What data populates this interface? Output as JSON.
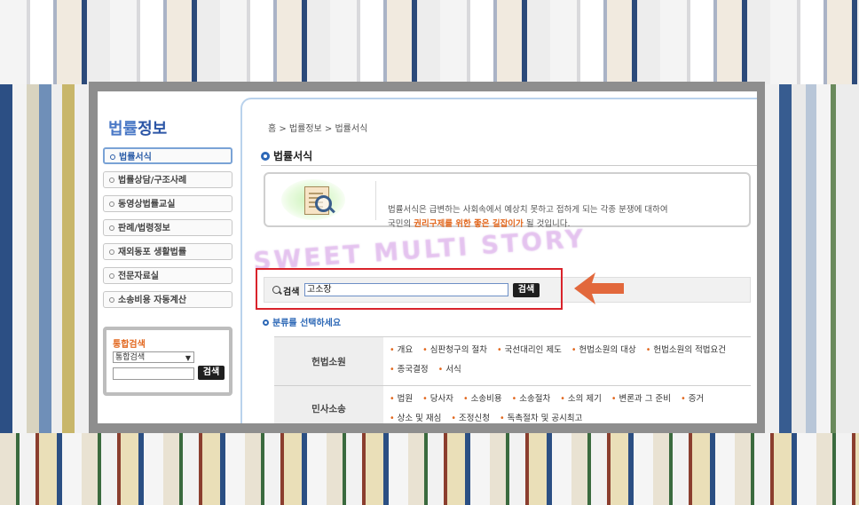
{
  "sidebar": {
    "brand": {
      "part1": "법률",
      "part2": "정보"
    },
    "items": [
      {
        "label": "법률서식"
      },
      {
        "label": "법률상담/구조사례"
      },
      {
        "label": "동영상법률교실"
      },
      {
        "label": "판례/법령정보"
      },
      {
        "label": "재외동포 생활법률"
      },
      {
        "label": "전문자료실"
      },
      {
        "label": "소송비용 자동계산"
      }
    ],
    "unified_search": {
      "title": "통합검색",
      "select_value": "통합검색",
      "button_label": "검색"
    }
  },
  "breadcrumb": "홈 > 법률정보 > 법률서식",
  "section_title": "법률서식",
  "intro": {
    "line1": "법률서식은 급변하는 사회속에서 예상치 못하고 접하게 되는 각종 분쟁에 대하여",
    "line2_prefix": "국민의 ",
    "line2_highlight": "권리구제를 위한 좋은 길잡이가",
    "line2_suffix": " 될 것입니다."
  },
  "watermark": "SWEET MULTI STORY",
  "search": {
    "label": "검색",
    "value": "고소장",
    "button_label": "검색"
  },
  "category_prompt": "분류를 선택하세요",
  "categories": [
    {
      "name": "헌법소원",
      "items": [
        "개요",
        "심판청구의 절차",
        "국선대리인 제도",
        "헌법소원의 대상",
        "헌법소원의 적법요건",
        "종국결정",
        "서식"
      ]
    },
    {
      "name": "민사소송",
      "items": [
        "법원",
        "당사자",
        "소송비용",
        "소송절차",
        "소의 제기",
        "변론과 그 준비",
        "증거",
        "상소 및 재심",
        "조정신청",
        "독촉절차 및 공시최고"
      ]
    }
  ],
  "colors": {
    "accent_blue": "#2c67b7",
    "highlight_orange": "#e2681f",
    "annotation_red": "#d9232b",
    "arrow_orange": "#e2683c"
  }
}
